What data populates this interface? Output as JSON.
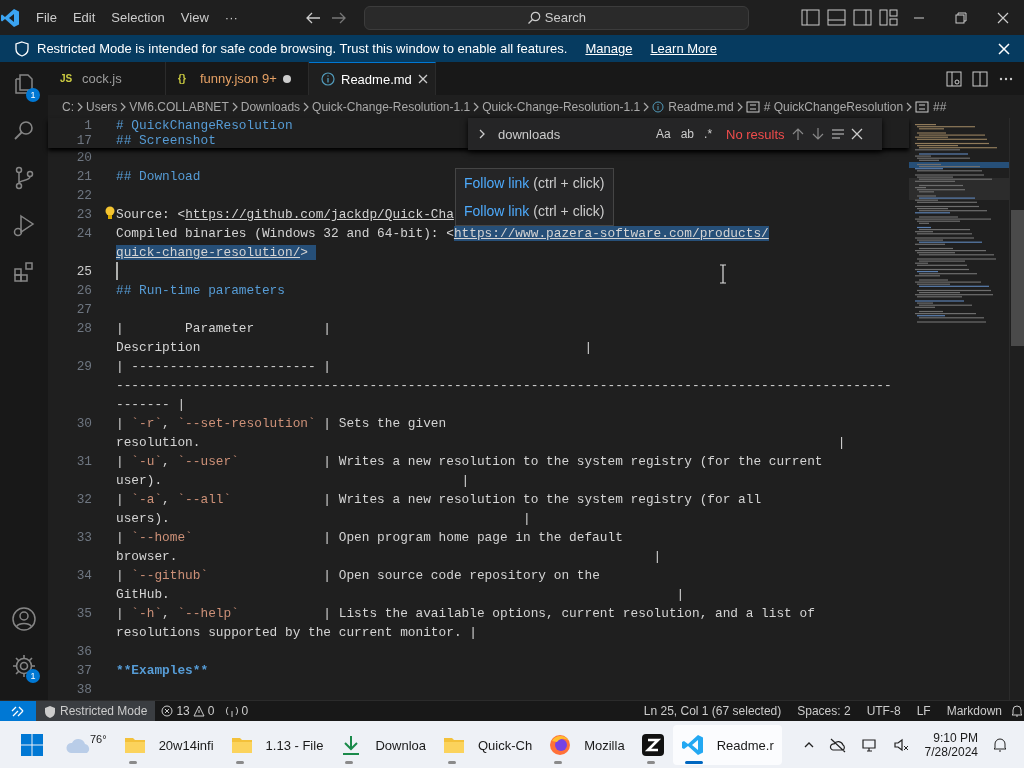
{
  "title_bar": {
    "menu": [
      "File",
      "Edit",
      "Selection",
      "View",
      "···"
    ],
    "search": "Search"
  },
  "banner": {
    "text": "Restricted Mode is intended for safe code browsing. Trust this window to enable all features.",
    "links": [
      "Manage",
      "Learn More"
    ]
  },
  "activity_bar": {
    "top": [
      {
        "kind": "explorer",
        "badge": "1"
      },
      {
        "kind": "search"
      },
      {
        "kind": "source-control"
      },
      {
        "kind": "run"
      },
      {
        "kind": "extensions"
      }
    ],
    "bottom": [
      {
        "kind": "account"
      },
      {
        "kind": "settings",
        "badge": "1"
      }
    ]
  },
  "tabs": [
    {
      "kind": "js",
      "icon_text": "JS",
      "label": "cock.js",
      "selected": false,
      "modified": false
    },
    {
      "kind": "json",
      "icon_text": "{}",
      "label": "funny.json",
      "badge": "9+",
      "selected": false,
      "modified": true
    },
    {
      "kind": "info",
      "label": "Readme.md",
      "selected": true,
      "modified": false
    }
  ],
  "breadcrumb": [
    {
      "kind": "folder",
      "text": "C:"
    },
    {
      "kind": "folder",
      "text": "Users"
    },
    {
      "kind": "folder",
      "text": "VM6.COLLABNET"
    },
    {
      "kind": "folder",
      "text": "Downloads"
    },
    {
      "kind": "folder",
      "text": "Quick-Change-Resolution-1.1"
    },
    {
      "kind": "folder",
      "text": "Quick-Change-Resolution-1.1"
    },
    {
      "kind": "file",
      "text": "Readme.md"
    },
    {
      "kind": "symbol",
      "text": "# QuickChangeResolution"
    },
    {
      "kind": "symbol",
      "text": "##"
    }
  ],
  "find": {
    "value": "downloads",
    "options": [
      "Aa",
      "ab",
      ".*"
    ],
    "result": "No results"
  },
  "hover": [
    {
      "link": "Follow link",
      "hint": "(ctrl + click)"
    },
    {
      "link": "Follow link",
      "hint": "(ctrl + click)"
    }
  ],
  "editor": {
    "sticky": [
      {
        "number": "1",
        "segments": [
          {
            "kind": "heading",
            "text": "# QuickChangeResolution"
          }
        ]
      },
      {
        "number": "17",
        "segments": [
          {
            "kind": "heading",
            "text": "## Screenshot"
          }
        ]
      }
    ],
    "lines": [
      {
        "number": "20",
        "current": false
      },
      {
        "number": "21",
        "current": false,
        "wraps": [
          {
            "segments": [
              {
                "kind": "heading",
                "text": "## Download"
              }
            ]
          }
        ]
      },
      {
        "number": "22",
        "current": false
      },
      {
        "number": "23",
        "current": false,
        "wraps": [
          {
            "segments": [
              {
                "kind": "text",
                "text": "Source: <"
              },
              {
                "kind": "link",
                "text": "https://github.com/jackdp/Quick-Cha"
              }
            ]
          }
        ]
      },
      {
        "number": "24",
        "current": false,
        "wraps": [
          {
            "segments": [
              {
                "kind": "text",
                "text": "Compiled binaries (Windows 32 and 64-bit): <"
              },
              {
                "kind": "link_selected",
                "text": "https://www.pazera-software.com/products/"
              }
            ]
          },
          {
            "segments": [
              {
                "kind": "link_selected",
                "text": "quick-change-resolution/"
              },
              {
                "kind": "text_selected",
                "text": "> "
              }
            ]
          }
        ]
      },
      {
        "number": "25",
        "current": true
      },
      {
        "number": "26",
        "current": false,
        "wraps": [
          {
            "segments": [
              {
                "kind": "heading",
                "text": "## Run-time parameters"
              }
            ]
          }
        ]
      },
      {
        "number": "27",
        "current": false
      },
      {
        "number": "28",
        "current": false,
        "wraps": [
          {
            "segments": [
              {
                "kind": "text",
                "text": "|        Parameter         |"
              }
            ]
          },
          {
            "segments": [
              {
                "kind": "text",
                "text": "Description                                                  |"
              }
            ]
          }
        ]
      },
      {
        "number": "29",
        "current": false,
        "wraps": [
          {
            "segments": [
              {
                "kind": "text",
                "text": "| ------------------------ |"
              }
            ]
          },
          {
            "segments": [
              {
                "kind": "text",
                "text": "-----------------------------------------------------------------------------------------------------"
              }
            ]
          },
          {
            "segments": [
              {
                "kind": "text",
                "text": "------- |"
              }
            ]
          }
        ]
      },
      {
        "number": "30",
        "current": false,
        "wraps": [
          {
            "segments": [
              {
                "kind": "text",
                "text": "| "
              },
              {
                "kind": "code",
                "text": "`-r`"
              },
              {
                "kind": "text",
                "text": ", "
              },
              {
                "kind": "code",
                "text": "`--set-resolution`"
              },
              {
                "kind": "text",
                "text": " | Sets the given"
              }
            ]
          },
          {
            "segments": [
              {
                "kind": "text",
                "text": "resolution.                                                                                   |"
              }
            ]
          }
        ]
      },
      {
        "number": "31",
        "current": false,
        "wraps": [
          {
            "segments": [
              {
                "kind": "text",
                "text": "| "
              },
              {
                "kind": "code",
                "text": "`-u`"
              },
              {
                "kind": "text",
                "text": ", "
              },
              {
                "kind": "code",
                "text": "`--user`"
              },
              {
                "kind": "text",
                "text": "           | Writes a new resolution to the system registry (for the current"
              }
            ]
          },
          {
            "segments": [
              {
                "kind": "text",
                "text": "user).                                       |"
              }
            ]
          }
        ]
      },
      {
        "number": "32",
        "current": false,
        "wraps": [
          {
            "segments": [
              {
                "kind": "text",
                "text": "| "
              },
              {
                "kind": "code",
                "text": "`-a`"
              },
              {
                "kind": "text",
                "text": ", "
              },
              {
                "kind": "code",
                "text": "`--all`"
              },
              {
                "kind": "text",
                "text": "            | Writes a new resolution to the system registry (for all"
              }
            ]
          },
          {
            "segments": [
              {
                "kind": "text",
                "text": "users).                                              |"
              }
            ]
          }
        ]
      },
      {
        "number": "33",
        "current": false,
        "wraps": [
          {
            "segments": [
              {
                "kind": "text",
                "text": "| "
              },
              {
                "kind": "code",
                "text": "`--home`"
              },
              {
                "kind": "text",
                "text": "                 | Open program home page in the default"
              }
            ]
          },
          {
            "segments": [
              {
                "kind": "text",
                "text": "browser.                                                              |"
              }
            ]
          }
        ]
      },
      {
        "number": "34",
        "current": false,
        "wraps": [
          {
            "segments": [
              {
                "kind": "text",
                "text": "| "
              },
              {
                "kind": "code",
                "text": "`--github`"
              },
              {
                "kind": "text",
                "text": "               | Open source code repository on the"
              }
            ]
          },
          {
            "segments": [
              {
                "kind": "text",
                "text": "GitHub.                                                                  |"
              }
            ]
          }
        ]
      },
      {
        "number": "35",
        "current": false,
        "wraps": [
          {
            "segments": [
              {
                "kind": "text",
                "text": "| "
              },
              {
                "kind": "code",
                "text": "`-h`"
              },
              {
                "kind": "text",
                "text": ", "
              },
              {
                "kind": "code",
                "text": "`--help`"
              },
              {
                "kind": "text",
                "text": "           | Lists the available options, current resolution, and a list of"
              }
            ]
          },
          {
            "segments": [
              {
                "kind": "text",
                "text": "resolutions supported by the current monitor. |"
              }
            ]
          }
        ]
      },
      {
        "number": "36",
        "current": false
      },
      {
        "number": "37",
        "current": false,
        "wraps": [
          {
            "segments": [
              {
                "kind": "bold",
                "text": "**Examples**"
              }
            ]
          }
        ]
      },
      {
        "number": "38",
        "current": false
      }
    ]
  },
  "status_bar": {
    "mode": "Restricted Mode",
    "errors": "13",
    "warnings": "0",
    "ports": "0",
    "right": [
      "Ln 25, Col 1 (67 selected)",
      "Spaces: 2",
      "UTF-8",
      "LF",
      "Markdown"
    ]
  },
  "taskbar": {
    "weather": "76°",
    "apps": [
      {
        "kind": "folder",
        "label": "20w14infi",
        "active": false
      },
      {
        "kind": "folder",
        "label": "1.13 - File",
        "active": false
      },
      {
        "kind": "download",
        "label": "Downloa",
        "active": false
      },
      {
        "kind": "folder",
        "label": "Quick-Ch",
        "active": false
      },
      {
        "kind": "firefox",
        "label": "Mozilla",
        "active": false
      },
      {
        "kind": "z",
        "active": false
      },
      {
        "kind": "vscode",
        "label": "Readme.r",
        "active": true
      }
    ],
    "time": "9:10 PM",
    "date": "7/28/2024"
  }
}
